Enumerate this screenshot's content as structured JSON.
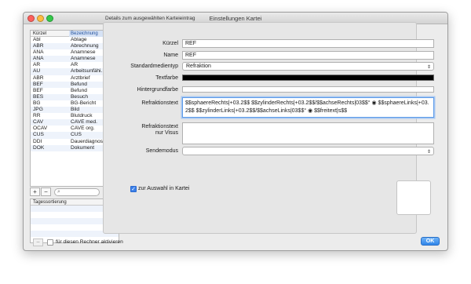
{
  "window": {
    "title": "Einstellungen Kartei"
  },
  "list": {
    "col_kuerzel": "Kürzel",
    "col_bezeichnung": "Bezeichnung",
    "rows": [
      {
        "k": "Abl",
        "b": "Ablage"
      },
      {
        "k": "ABR",
        "b": "Abrechnung"
      },
      {
        "k": "ANA",
        "b": "Anamnese"
      },
      {
        "k": "ANA",
        "b": "Anamnese"
      },
      {
        "k": "AR",
        "b": "AR"
      },
      {
        "k": "AU",
        "b": "Arbeitsunfähi..."
      },
      {
        "k": "ABR",
        "b": "Arztbrief"
      },
      {
        "k": "BEF",
        "b": "Befund"
      },
      {
        "k": "BEF",
        "b": "Befund"
      },
      {
        "k": "BES",
        "b": "Besuch"
      },
      {
        "k": "BG",
        "b": "BG-Bericht"
      },
      {
        "k": "JPG",
        "b": "Bild"
      },
      {
        "k": "RR",
        "b": "Blutdruck"
      },
      {
        "k": "CAV",
        "b": "CAVE med."
      },
      {
        "k": "OCAV",
        "b": "CAVE org."
      },
      {
        "k": "CUS",
        "b": "CUS"
      },
      {
        "k": "DDI",
        "b": "Dauerdiagnose"
      },
      {
        "k": "DOK",
        "b": "Dokument"
      }
    ],
    "add_label": "+",
    "remove_label": "−",
    "search_icon_glyph": "⌕",
    "menu_label": "▼"
  },
  "tage": {
    "header": "Tagessortierung"
  },
  "bottom": {
    "remove_label": "−",
    "checkbox_label": "für diesen Rechner aktivieren"
  },
  "details": {
    "group_label": "Details zum ausgewählten Karteieintrag",
    "kuerzel_label": "Kürzel",
    "kuerzel_value": "REF",
    "name_label": "Name",
    "name_value": "REF",
    "standard_label": "Standardmedientyp",
    "standard_value": "Refraktion",
    "textfarbe_label": "Textfarbe",
    "textfarbe_color": "#000000",
    "hintergrund_label": "Hintergrundfarbe",
    "refraktionstext_label": "Refraktionstext",
    "refraktionstext_value": "$$sphaereRechts|+03.2$$ $$zylinderRechts|+03.2$$/$$achseRechts|03$$° ◉ $$sphaereLinks|+03.2$$ $$zylinderLinks|+03.2$$/$$achseLinks|03$$° ◉ $$freitext|s$$",
    "refraktionstext_visus_label_1": "Refraktionstext",
    "refraktionstext_visus_label_2": "nur Visus",
    "sendemodus_label": "Sendemodus",
    "auswahl_label": "zur Auswahl in Kartei",
    "auswahl_checked": true
  },
  "ok_label": "OK"
}
